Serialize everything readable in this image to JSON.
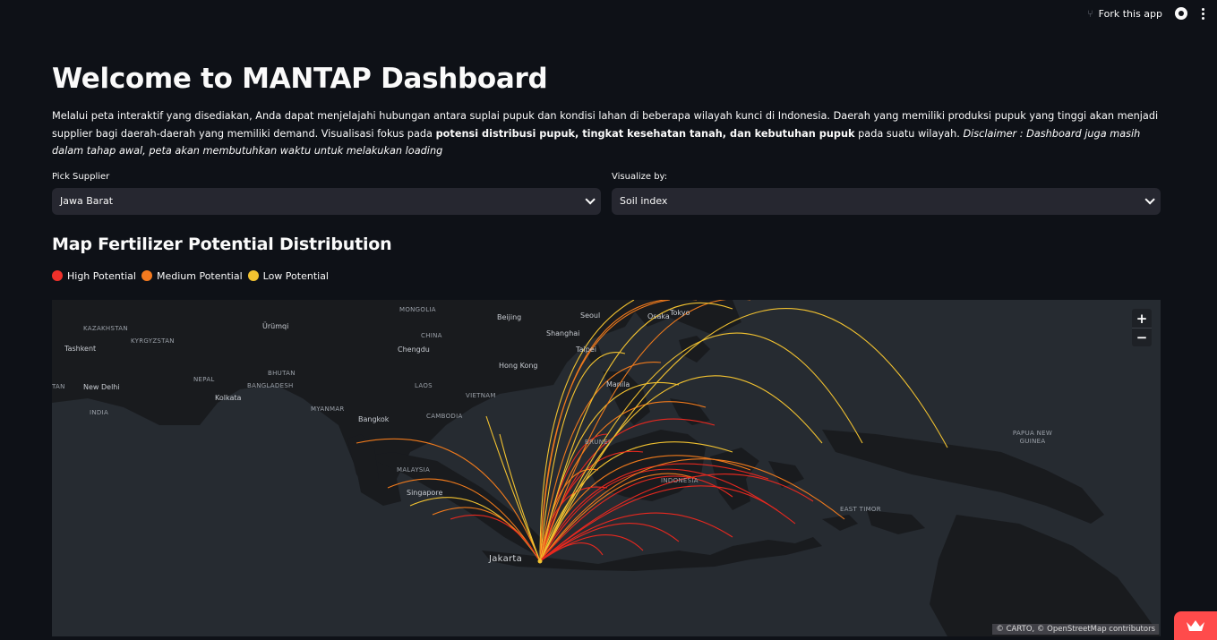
{
  "topbar": {
    "fork_label": "Fork this app"
  },
  "main": {
    "title": "Welcome to MANTAP Dashboard",
    "intro_1": "Melalui peta interaktif yang disediakan, Anda dapat menjelajahi hubungan antara suplai pupuk dan kondisi lahan di beberapa wilayah kunci di Indonesia. Daerah yang memiliki produksi pupuk yang tinggi akan menjadi supplier bagi daerah-daerah yang memiliki demand. Visualisasi fokus pada ",
    "intro_bold": "potensi distribusi pupuk, tingkat kesehatan tanah, dan kebutuhan pupuk",
    "intro_2": " pada suatu wilayah. ",
    "intro_italic": "Disclaimer : Dashboard juga masih dalam tahap awal, peta akan membutuhkan waktu untuk melakukan loading",
    "supplier_label": "Pick Supplier",
    "supplier_value": "Jawa Barat",
    "visualize_label": "Visualize by:",
    "visualize_value": "Soil index",
    "map_title": "Map Fertilizer Potential Distribution",
    "legend": [
      {
        "label": "High Potential",
        "color": "#f0302a"
      },
      {
        "label": "Medium Potential",
        "color": "#f57a1f"
      },
      {
        "label": "Low Potential",
        "color": "#f2c230"
      }
    ]
  },
  "map": {
    "zoom_in": "+",
    "zoom_out": "−",
    "attribution": "© CARTO, © OpenStreetMap contributors",
    "labels": {
      "mongolia": "MONGOLIA",
      "beijing": "Beijing",
      "seoul": "Seoul",
      "tokyo": "Tokyo",
      "osaka": "Osaka",
      "kazakhstan": "KAZAKHSTAN",
      "urumqi": "Ürümqi",
      "kyrgyzstan": "KYRGYZSTAN",
      "china": "CHINA",
      "shanghai": "Shanghai",
      "tashkent": "Tashkent",
      "chengdu": "Chengdu",
      "taipei": "Taipei",
      "hongkong": "Hong Kong",
      "bhutan": "BHUTAN",
      "nepal": "NEPAL",
      "bangladesh": "BANGLADESH",
      "laos": "LAOS",
      "manila": "Manila",
      "tan": "TAN",
      "newdelhi": "New Delhi",
      "kolkata": "Kolkata",
      "vietnam": "VIETNAM",
      "india": "INDIA",
      "myanmar": "MYANMAR",
      "bangkok": "Bangkok",
      "cambodia": "CAMBODIA",
      "brunei": "BRUNEI",
      "png": "PAPUA NEW GUINEA",
      "malaysia": "MALAYSIA",
      "singapore": "Singapore",
      "indonesia": "INDONESIA",
      "easttimor": "EAST TIMOR",
      "jakarta": "Jakarta"
    },
    "origin": "Jakarta",
    "arc_colors": {
      "high": "#e8281f",
      "medium": "#f07a1c",
      "low": "#f2c230"
    }
  }
}
